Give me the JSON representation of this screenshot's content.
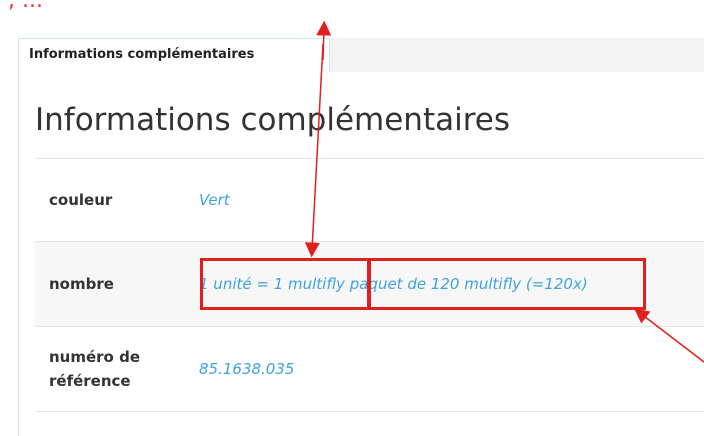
{
  "top_fragment": ", ...",
  "tab": {
    "label": "Informations complémentaires"
  },
  "section": {
    "title": "Informations complémentaires"
  },
  "attributes": [
    {
      "label": "couleur",
      "value": "Vert"
    },
    {
      "label": "nombre",
      "value_part1": "1 unité = 1 multifly",
      "value_part2": "paquet de 120 multifly (=120x)"
    },
    {
      "label": "numéro de référence",
      "value": "85.1638.035"
    }
  ],
  "annotation_color": "#e0201e",
  "link_color": "#3da3e0"
}
